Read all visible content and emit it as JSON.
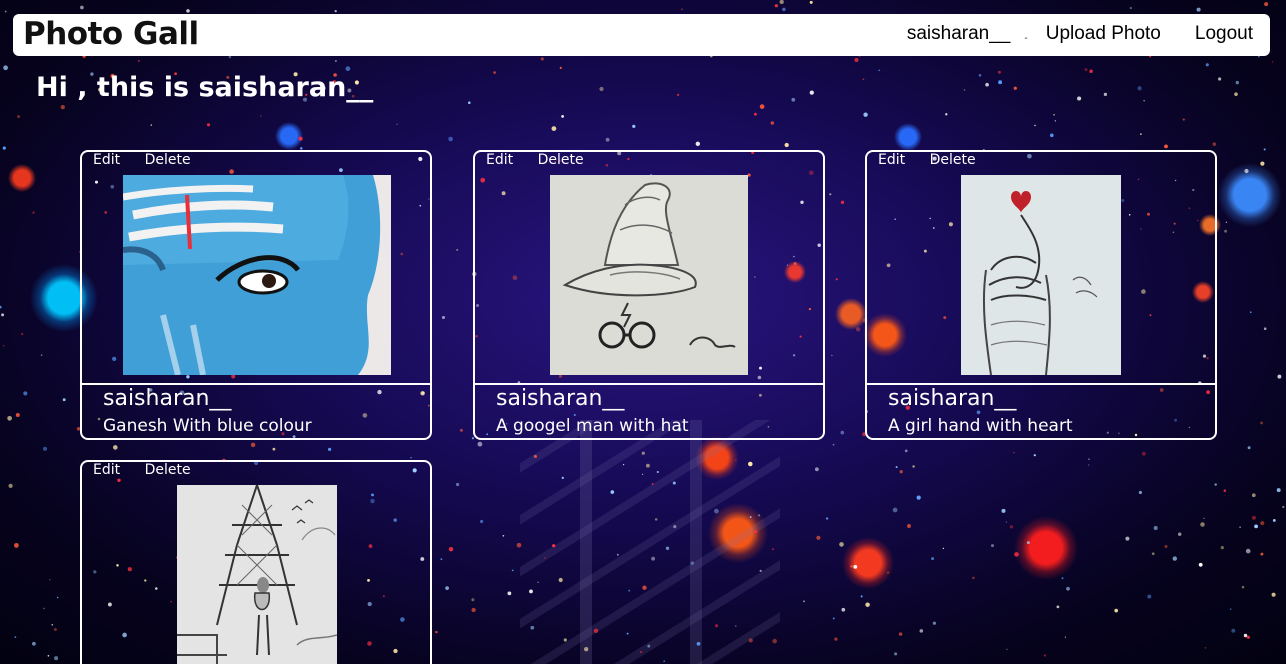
{
  "app": {
    "brand": "Photo Gall"
  },
  "nav": {
    "username": "saisharan__",
    "separator": "-",
    "upload_label": "Upload Photo",
    "logout_label": "Logout"
  },
  "greeting": "Hi , this is saisharan__",
  "cards": [
    {
      "edit_label": "Edit",
      "delete_label": "Delete",
      "user": "saisharan__",
      "caption": "Ganesh With blue colour",
      "image": "blue painted face with eye and red tilak"
    },
    {
      "edit_label": "Edit",
      "delete_label": "Delete",
      "user": "saisharan__",
      "caption": "A googel man with hat",
      "image": "pencil sketch of wizard hat with glasses"
    },
    {
      "edit_label": "Edit",
      "delete_label": "Delete",
      "user": "saisharan__",
      "caption": "A girl hand with heart",
      "image": "sketch of hand making finger heart"
    },
    {
      "edit_label": "Edit",
      "delete_label": "Delete",
      "image": "pencil sketch of girl under Eiffel tower"
    }
  ]
}
